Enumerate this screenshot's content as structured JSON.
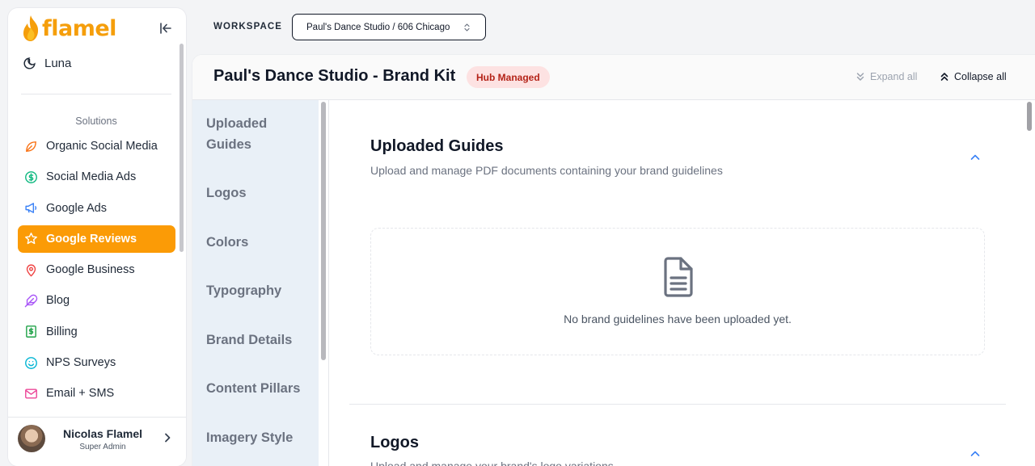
{
  "brand": {
    "name": "flamel",
    "color": "#f59e0b"
  },
  "sidebar": {
    "top_item": {
      "label": "Luna",
      "icon": "moon-icon"
    },
    "section_label": "Solutions",
    "items": [
      {
        "label": "Organic Social Media",
        "icon": "leaf-icon",
        "color": "#f97316"
      },
      {
        "label": "Social Media Ads",
        "icon": "dollar-circle-icon",
        "color": "#10b981"
      },
      {
        "label": "Google Ads",
        "icon": "megaphone-icon",
        "color": "#3b82f6"
      },
      {
        "label": "Google Reviews",
        "icon": "star-icon",
        "color": "#ffffff",
        "active": true
      },
      {
        "label": "Google Business",
        "icon": "map-pin-icon",
        "color": "#ef4444"
      },
      {
        "label": "Blog",
        "icon": "feather-icon",
        "color": "#a855f7"
      },
      {
        "label": "Billing",
        "icon": "bill-icon",
        "color": "#22a34a"
      },
      {
        "label": "NPS Surveys",
        "icon": "smile-icon",
        "color": "#06b6d4"
      },
      {
        "label": "Email + SMS",
        "icon": "mail-icon",
        "color": "#ec4899"
      }
    ],
    "user": {
      "name": "Nicolas Flamel",
      "role": "Super Admin"
    }
  },
  "workspace": {
    "label": "WORKSPACE",
    "selected": "Paul's Dance Studio / 606 Chicago"
  },
  "page": {
    "title": "Paul's Dance Studio - Brand Kit",
    "badge": "Hub Managed",
    "expand_all": "Expand all",
    "collapse_all": "Collapse all"
  },
  "section_nav": [
    "Uploaded Guides",
    "Logos",
    "Colors",
    "Typography",
    "Brand Details",
    "Content Pillars",
    "Imagery Style"
  ],
  "sections": {
    "uploaded_guides": {
      "title": "Uploaded Guides",
      "description": "Upload and manage PDF documents containing your brand guidelines",
      "empty_text": "No brand guidelines have been uploaded yet."
    },
    "logos": {
      "title": "Logos",
      "description": "Upload and manage your brand's logo variations"
    }
  }
}
